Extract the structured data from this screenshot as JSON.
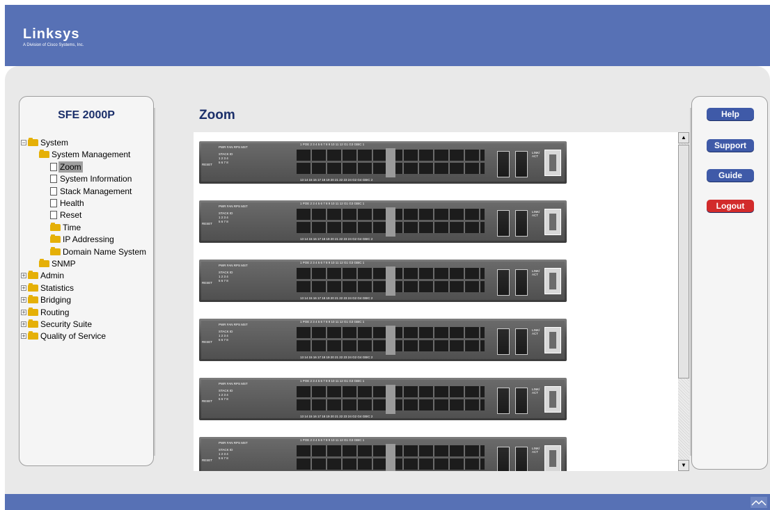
{
  "header": {
    "brand": "Linksys",
    "brand_sub": "A Division of Cisco Systems, Inc."
  },
  "sidebar": {
    "model_title": "SFE 2000P",
    "tree": [
      {
        "label": "System",
        "type": "folder",
        "expander": "minus",
        "selected": false
      },
      {
        "label": "System Management",
        "type": "folder",
        "expander": "",
        "selected": false
      },
      {
        "label": "Zoom",
        "type": "page",
        "expander": "",
        "selected": true
      },
      {
        "label": "System Information",
        "type": "page",
        "expander": "",
        "selected": false
      },
      {
        "label": "Stack Management",
        "type": "page",
        "expander": "",
        "selected": false
      },
      {
        "label": "Health",
        "type": "page",
        "expander": "",
        "selected": false
      },
      {
        "label": "Reset",
        "type": "page",
        "expander": "",
        "selected": false
      },
      {
        "label": "Time",
        "type": "folder",
        "expander": "",
        "selected": false
      },
      {
        "label": "IP Addressing",
        "type": "folder",
        "expander": "",
        "selected": false
      },
      {
        "label": "Domain Name System",
        "type": "folder",
        "expander": "",
        "selected": false
      },
      {
        "label": "SNMP",
        "type": "folder",
        "expander": "",
        "selected": false
      },
      {
        "label": "Admin",
        "type": "folder",
        "expander": "plus",
        "selected": false
      },
      {
        "label": "Statistics",
        "type": "folder",
        "expander": "plus",
        "selected": false
      },
      {
        "label": "Bridging",
        "type": "folder",
        "expander": "plus",
        "selected": false
      },
      {
        "label": "Routing",
        "type": "folder",
        "expander": "plus",
        "selected": false
      },
      {
        "label": "Security Suite",
        "type": "folder",
        "expander": "plus",
        "selected": false
      },
      {
        "label": "Quality of Service",
        "type": "folder",
        "expander": "plus",
        "selected": false
      }
    ]
  },
  "main": {
    "title": "Zoom",
    "switch_units": [
      {
        "reset_label": "RESET",
        "stack_label": "STACK ID",
        "led_header": "PWR FAN RPS MST",
        "stack_row1": "1 2 3 4",
        "stack_row2": "5 6 7 8"
      },
      {
        "reset_label": "RESET",
        "stack_label": "STACK ID",
        "led_header": "PWR FAN RPS MST",
        "stack_row1": "1 2 3 4",
        "stack_row2": "5 6 7 8"
      },
      {
        "reset_label": "RESET",
        "stack_label": "STACK ID",
        "led_header": "PWR FAN RPS MST",
        "stack_row1": "1 2 3 4",
        "stack_row2": "5 6 7 8"
      },
      {
        "reset_label": "RESET",
        "stack_label": "STACK ID",
        "led_header": "PWR FAN RPS MST",
        "stack_row1": "1 2 3 4",
        "stack_row2": "5 6 7 8"
      },
      {
        "reset_label": "RESET",
        "stack_label": "STACK ID",
        "led_header": "PWR FAN RPS MST",
        "stack_row1": "1 2 3 4",
        "stack_row2": "5 6 7 8"
      },
      {
        "reset_label": "RESET",
        "stack_label": "STACK ID",
        "led_header": "PWR FAN RPS MST",
        "stack_row1": "1 2 3 4",
        "stack_row2": "5 6 7 8"
      }
    ],
    "port_top_labels": "1 POE 2 3 4 5 6 7 8 9 10 11 12 G1 G3 GBIC 1",
    "port_bot_labels": "13 14 15 16 17 18 19 20 21 22 23 24 G2 G4 GBIC 2",
    "link_label": "LINK/ ACT"
  },
  "actions": {
    "help": "Help",
    "support": "Support",
    "guide": "Guide",
    "logout": "Logout"
  },
  "colors": {
    "banner": "#5771b5",
    "button_blue": "#3f5aa8",
    "button_red": "#d22b2b",
    "title": "#1b2f6a"
  }
}
